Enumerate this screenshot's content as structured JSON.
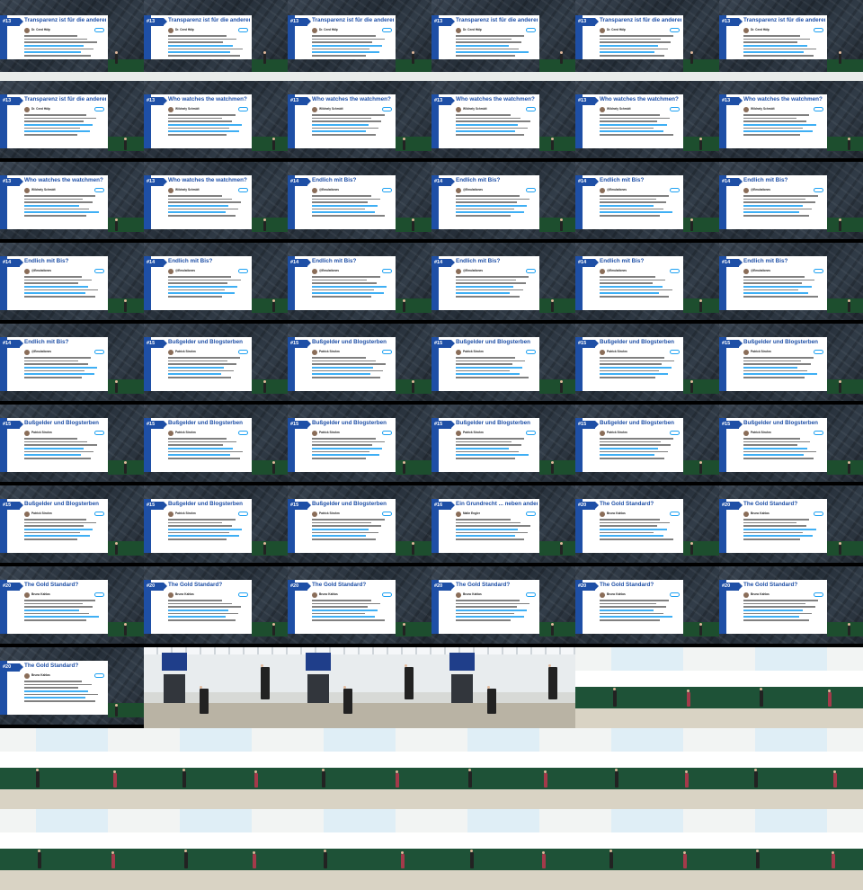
{
  "layout_note_free": true,
  "colors": {
    "accent": "#1e4fa6",
    "link": "#1da1f2",
    "board": "#1e5237"
  },
  "slides": [
    {
      "num": "#13",
      "title": "Transparenz ist für die anderen...",
      "handle": "Dr. Ceed Hälp"
    },
    {
      "num": "#13",
      "title": "Transparenz ist für die anderen...",
      "handle": "Dr. Ceed Hälp"
    },
    {
      "num": "#13",
      "title": "Transparenz ist für die anderen...",
      "handle": "Dr. Ceed Hälp"
    },
    {
      "num": "#13",
      "title": "Transparenz ist für die anderen...",
      "handle": "Dr. Ceed Hälp"
    },
    {
      "num": "#13",
      "title": "Transparenz ist für die anderen...",
      "handle": "Dr. Ceed Hälp"
    },
    {
      "num": "#13",
      "title": "Transparenz ist für die anderen...",
      "handle": "Dr. Ceed Hälp"
    },
    {
      "num": "#13",
      "title": "Transparenz ist für die anderen...",
      "handle": "Dr. Ceed Hälp"
    },
    {
      "num": "#13",
      "title": "Who watches the watchmen?",
      "handle": "Wildnely Schmidt"
    },
    {
      "num": "#13",
      "title": "Who watches the watchmen?",
      "handle": "Wildnely Schmidt"
    },
    {
      "num": "#13",
      "title": "Who watches the watchmen?",
      "handle": "Wildnely Schmidt"
    },
    {
      "num": "#13",
      "title": "Who watches the watchmen?",
      "handle": "Wildnely Schmidt"
    },
    {
      "num": "#13",
      "title": "Who watches the watchmen?",
      "handle": "Wildnely Schmidt"
    },
    {
      "num": "#13",
      "title": "Who watches the watchmen?",
      "handle": "Wildnely Schmidt"
    },
    {
      "num": "#13",
      "title": "Who watches the watchmen?",
      "handle": "Wildnely Schmidt"
    },
    {
      "num": "#14",
      "title": "Endlich mit Bis?",
      "handle": "@Emulationes"
    },
    {
      "num": "#14",
      "title": "Endlich mit Bis?",
      "handle": "@Emulationes"
    },
    {
      "num": "#14",
      "title": "Endlich mit Bis?",
      "handle": "@Emulationes"
    },
    {
      "num": "#14",
      "title": "Endlich mit Bis?",
      "handle": "@Emulationes"
    },
    {
      "num": "#14",
      "title": "Endlich mit Bis?",
      "handle": "@Emulationes"
    },
    {
      "num": "#14",
      "title": "Endlich mit Bis?",
      "handle": "@Emulationes"
    },
    {
      "num": "#14",
      "title": "Endlich mit Bis?",
      "handle": "@Emulationes"
    },
    {
      "num": "#14",
      "title": "Endlich mit Bis?",
      "handle": "@Emulationes"
    },
    {
      "num": "#14",
      "title": "Endlich mit Bis?",
      "handle": "@Emulationes"
    },
    {
      "num": "#14",
      "title": "Endlich mit Bis?",
      "handle": "@Emulationes"
    },
    {
      "num": "#14",
      "title": "Endlich mit Bis?",
      "handle": "@Emulationes"
    },
    {
      "num": "#15",
      "title": "Bußgelder und Blogsterben",
      "handle": "Patrick Strohm"
    },
    {
      "num": "#15",
      "title": "Bußgelder und Blogsterben",
      "handle": "Patrick Strohm"
    },
    {
      "num": "#15",
      "title": "Bußgelder und Blogsterben",
      "handle": "Patrick Strohm"
    },
    {
      "num": "#15",
      "title": "Bußgelder und Blogsterben",
      "handle": "Patrick Strohm"
    },
    {
      "num": "#15",
      "title": "Bußgelder und Blogsterben",
      "handle": "Patrick Strohm"
    },
    {
      "num": "#15",
      "title": "Bußgelder und Blogsterben",
      "handle": "Patrick Strohm"
    },
    {
      "num": "#15",
      "title": "Bußgelder und Blogsterben",
      "handle": "Patrick Strohm"
    },
    {
      "num": "#15",
      "title": "Bußgelder und Blogsterben",
      "handle": "Patrick Strohm"
    },
    {
      "num": "#15",
      "title": "Bußgelder und Blogsterben",
      "handle": "Patrick Strohm"
    },
    {
      "num": "#15",
      "title": "Bußgelder und Blogsterben",
      "handle": "Patrick Strohm"
    },
    {
      "num": "#15",
      "title": "Bußgelder und Blogsterben",
      "handle": "Patrick Strohm"
    },
    {
      "num": "#15",
      "title": "Bußgelder und Blogsterben",
      "handle": "Patrick Strohm"
    },
    {
      "num": "#15",
      "title": "Bußgelder und Blogsterben",
      "handle": "Patrick Strohm"
    },
    {
      "num": "#15",
      "title": "Bußgelder und Blogsterben",
      "handle": "Patrick Strohm"
    },
    {
      "num": "#16",
      "title": "Ein Grundrecht ... neben anderen",
      "handle": "Malte Engler"
    },
    {
      "num": "#20",
      "title": "The Gold Standard?",
      "handle": "Bruno Kahlas"
    },
    {
      "num": "#20",
      "title": "The Gold Standard?",
      "handle": "Bruno Kahlas"
    },
    {
      "num": "#20",
      "title": "The Gold Standard?",
      "handle": "Bruno Kahlas"
    },
    {
      "num": "#20",
      "title": "The Gold Standard?",
      "handle": "Bruno Kahlas"
    },
    {
      "num": "#20",
      "title": "The Gold Standard?",
      "handle": "Bruno Kahlas"
    },
    {
      "num": "#20",
      "title": "The Gold Standard?",
      "handle": "Bruno Kahlas"
    },
    {
      "num": "#20",
      "title": "The Gold Standard?",
      "handle": "Bruno Kahlas"
    },
    {
      "num": "#20",
      "title": "The Gold Standard?",
      "handle": "Bruno Kahlas"
    },
    {
      "num": "#20",
      "title": "The Gold Standard?",
      "handle": "Bruno Kahlas"
    }
  ]
}
